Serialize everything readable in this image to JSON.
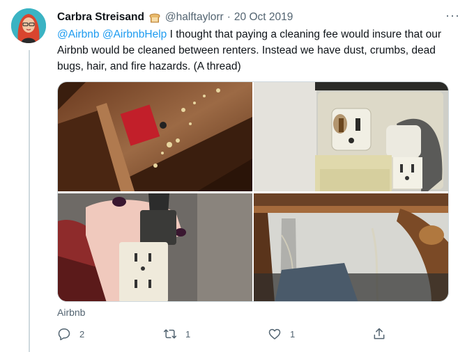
{
  "tweet": {
    "display_name": "Carbra Streisand",
    "name_emoji": "bread-emoji",
    "handle": "@halftaylorr",
    "separator": "·",
    "date": "20 Oct 2019",
    "more_label": "···",
    "mention_1": "@Airbnb",
    "mention_2": "@AirbnbHelp",
    "body": " I thought that paying a cleaning fee would insure that our Airbnb would be cleaned between renters. Instead we have dust, crumbs, dead bugs, hair, and fire hazards. (A thread)",
    "card_source": "Airbnb"
  },
  "photos": [
    {
      "icon": "dirty-wood-surface-photo"
    },
    {
      "icon": "burnt-wall-outlet-photo"
    },
    {
      "icon": "damaged-plug-in-hand-photo"
    },
    {
      "icon": "dusty-table-underside-photo"
    }
  ],
  "actions": {
    "reply": {
      "icon": "reply-icon",
      "count": "2"
    },
    "retweet": {
      "icon": "retweet-icon",
      "count": "1"
    },
    "like": {
      "icon": "heart-icon",
      "count": "1"
    },
    "share": {
      "icon": "share-icon",
      "count": ""
    }
  },
  "colors": {
    "link": "#1d9bf0",
    "muted": "#536471",
    "text": "#0f1419",
    "avatar_bg": "#3bb3c3"
  }
}
